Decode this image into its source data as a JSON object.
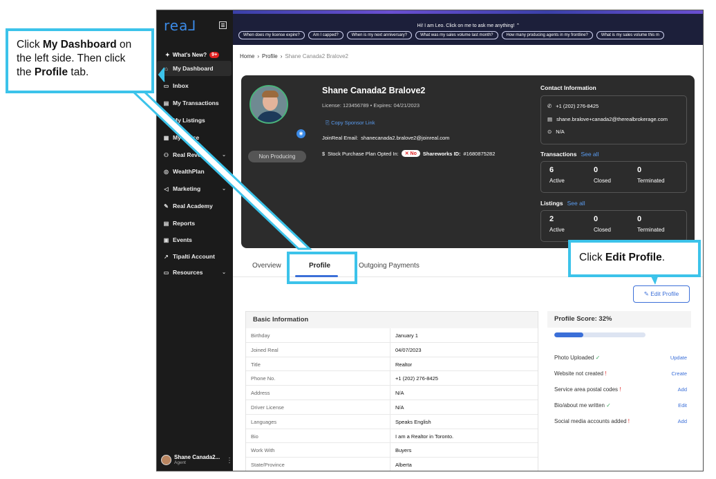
{
  "callouts": {
    "left": {
      "pre": "Click ",
      "b1": "My Dashboard",
      "mid": " on the left side. Then click the ",
      "b2": "Profile",
      "post": " tab."
    },
    "right": {
      "pre": "Click ",
      "b1": "Edit Profile",
      "post": "."
    }
  },
  "sidebar": {
    "logo": "rea⅃",
    "whats_new": "What's New?",
    "whats_new_badge": "9+",
    "items": [
      {
        "label": "My Dashboard",
        "icon": "home-icon"
      },
      {
        "label": "Inbox",
        "icon": "inbox-icon"
      },
      {
        "label": "My Transactions",
        "icon": "clipboard-icon"
      },
      {
        "label": "My Listings",
        "icon": "listing-icon"
      },
      {
        "label": "My Office",
        "icon": "office-icon"
      },
      {
        "label": "Real Revenue",
        "icon": "revenue-icon"
      },
      {
        "label": "WealthPlan",
        "icon": "wealth-icon"
      },
      {
        "label": "Marketing",
        "icon": "megaphone-icon"
      },
      {
        "label": "Real Academy",
        "icon": "academy-icon"
      },
      {
        "label": "Reports",
        "icon": "report-icon"
      },
      {
        "label": "Events",
        "icon": "calendar-icon"
      },
      {
        "label": "Tipalti Account",
        "icon": "external-link-icon"
      },
      {
        "label": "Resources",
        "icon": "folder-icon"
      }
    ],
    "user": {
      "name": "Shane Canada2...",
      "role": "Agent"
    }
  },
  "leo": {
    "title": "Hi! I am Leo. Click on me to ask me anything!",
    "chips": [
      "When does my license expire?",
      "Am I capped?",
      "When is my next anniversary?",
      "What was my sales volume last month?",
      "How many producing agents in my frontline?",
      "What is my sales volume this m"
    ]
  },
  "breadcrumb": [
    "Home",
    "Profile",
    "Shane Canada2 Bralove2"
  ],
  "profile": {
    "name": "Shane Canada2 Bralove2",
    "license": "License: 123456789  •  Expires: 04/21/2023",
    "sponsor_link": "Copy Sponsor Link",
    "email_label": "JoinReal Email:",
    "email": "shanecanada2.bralove2@joinreal.com",
    "stock_label": "Stock Purchase Plan Opted In:",
    "stock_value": "No",
    "shareworks_label": "Shareworks ID:",
    "shareworks_id": "#1680875282",
    "status": "Non Producing"
  },
  "contact": {
    "title": "Contact Information",
    "phone": "+1 (202) 276-8425",
    "email": "shane.bralove+canada2@therealbrokerage.com",
    "location": "N/A"
  },
  "transactions": {
    "title": "Transactions",
    "see_all": "See all",
    "active": "6",
    "closed": "0",
    "terminated": "0"
  },
  "listings": {
    "title": "Listings",
    "see_all": "See all",
    "active": "2",
    "closed": "0",
    "terminated": "0"
  },
  "stat_labels": {
    "active": "Active",
    "closed": "Closed",
    "terminated": "Terminated"
  },
  "tabs": [
    "Overview",
    "Profile",
    "Outgoing Payments"
  ],
  "edit_button": "Edit Profile",
  "basic_info": {
    "title": "Basic Information",
    "rows": [
      {
        "k": "Birthday",
        "v": "January 1"
      },
      {
        "k": "Joined Real",
        "v": "04/07/2023"
      },
      {
        "k": "Title",
        "v": "Realtor"
      },
      {
        "k": "Phone No.",
        "v": "+1 (202) 276-8425"
      },
      {
        "k": "Address",
        "v": "N/A"
      },
      {
        "k": "Driver License",
        "v": "N/A"
      },
      {
        "k": "Languages",
        "v": "Speaks English"
      },
      {
        "k": "Bio",
        "v": "I am a Realtor in Toronto."
      },
      {
        "k": "Work With",
        "v": "Buyers"
      },
      {
        "k": "State/Province",
        "v": "Alberta"
      }
    ]
  },
  "profile_score": {
    "title": "Profile Score: 32%",
    "percent": 32,
    "items": [
      {
        "label": "Photo Uploaded",
        "status": "ok",
        "action": "Update"
      },
      {
        "label": "Website not created",
        "status": "warn",
        "action": "Create"
      },
      {
        "label": "Service area postal codes",
        "status": "warn",
        "action": "Add"
      },
      {
        "label": "Bio/about me written",
        "status": "ok",
        "action": "Edit"
      },
      {
        "label": "Social media accounts added",
        "status": "warn",
        "action": "Add"
      }
    ]
  }
}
